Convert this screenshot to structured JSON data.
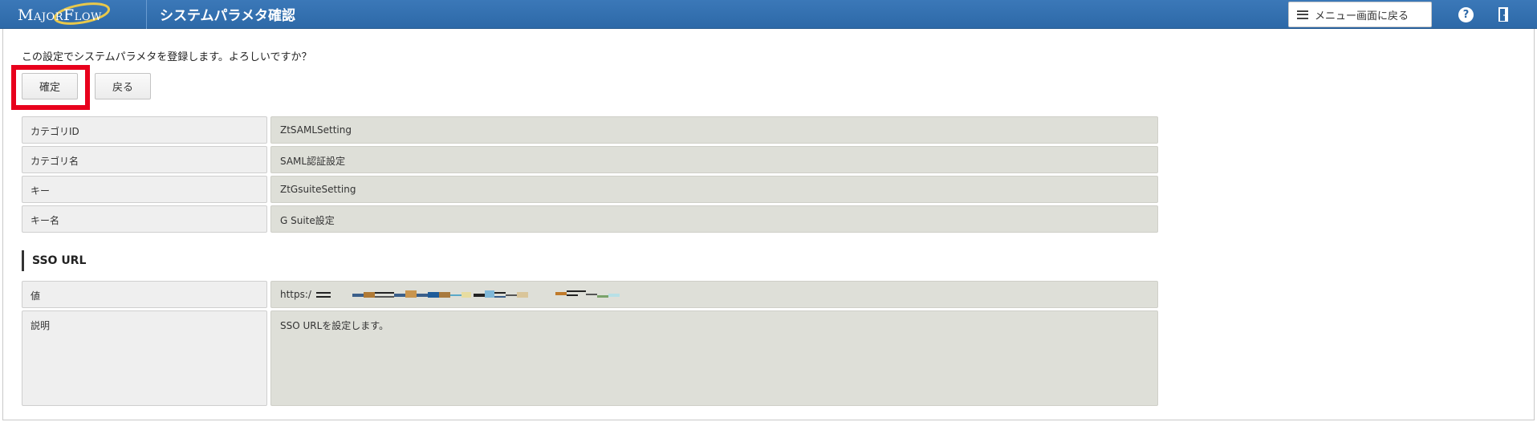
{
  "app": {
    "logo_text": "MajorFlow",
    "page_title": "システムパラメタ確認",
    "menu_button_label": "メニュー画面に戻る",
    "help_label": "?"
  },
  "main": {
    "confirm_message": "この設定でシステムパラメタを登録します。よろしいですか？",
    "confirm_button": "確定",
    "back_button": "戻る"
  },
  "params": [
    {
      "label": "カテゴリID",
      "value": "ZtSAMLSetting"
    },
    {
      "label": "カテゴリ名",
      "value": "SAML認証設定"
    },
    {
      "label": "キー",
      "value": "ZtGsuiteSetting"
    },
    {
      "label": "キー名",
      "value": "G Suite設定"
    }
  ],
  "sso_section": {
    "title": "SSO URL",
    "value_label": "値",
    "value_visible": "https:/",
    "description_label": "説明",
    "description": "SSO URLを設定します。"
  },
  "colors": {
    "header_blue": "#2d69a8",
    "highlight_red": "#e8001c",
    "value_bg": "#dedfd8",
    "label_bg": "#efefef"
  }
}
